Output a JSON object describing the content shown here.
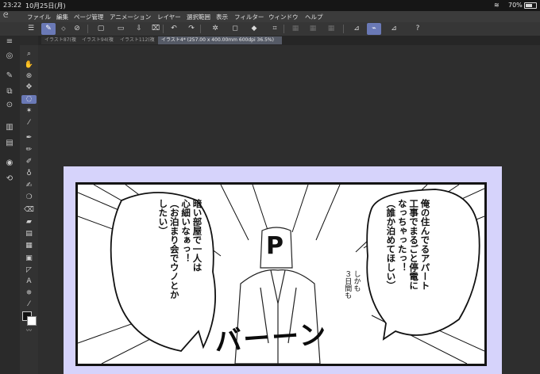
{
  "status": {
    "time": "23:22",
    "date": "10月25日(月)",
    "battery": "70%"
  },
  "menu": [
    "ファイル",
    "編集",
    "ページ管理",
    "アニメーション",
    "レイヤー",
    "選択範囲",
    "表示",
    "フィルター",
    "ウィンドウ",
    "ヘルプ"
  ],
  "tabs": [
    "イラスト87(複",
    "イラスト94(複",
    "イラスト112(複",
    "イラスト4* (257.00 x 400.00mm 600dpi 36.5%)"
  ],
  "toolbar_icons": [
    "menu-icon",
    "quick-access-icon",
    "pen-icon",
    "new-file-icon",
    "open-folder-icon",
    "save-icon",
    "clear-icon",
    "undo-icon",
    "redo-icon",
    "transform-icon",
    "fill-icon",
    "crop-icon",
    "layer-icon",
    "ruler-icon",
    "pen-pressure-icon",
    "pen-alt-icon",
    "help-icon"
  ],
  "manga": {
    "bubble_left": [
      "暗い部屋で一人は",
      "心細いなぁっ！",
      "（お泊まり会でウノとか",
      "したい）"
    ],
    "bubble_right": [
      "俺の住んでるアパート",
      "工事でまるごと停電に",
      "なっちゃったっ！",
      "（誰か泊めてほしい）"
    ],
    "note": [
      "しかも",
      "３日間も"
    ],
    "sfx": "バーーン",
    "head_letter": "P"
  }
}
